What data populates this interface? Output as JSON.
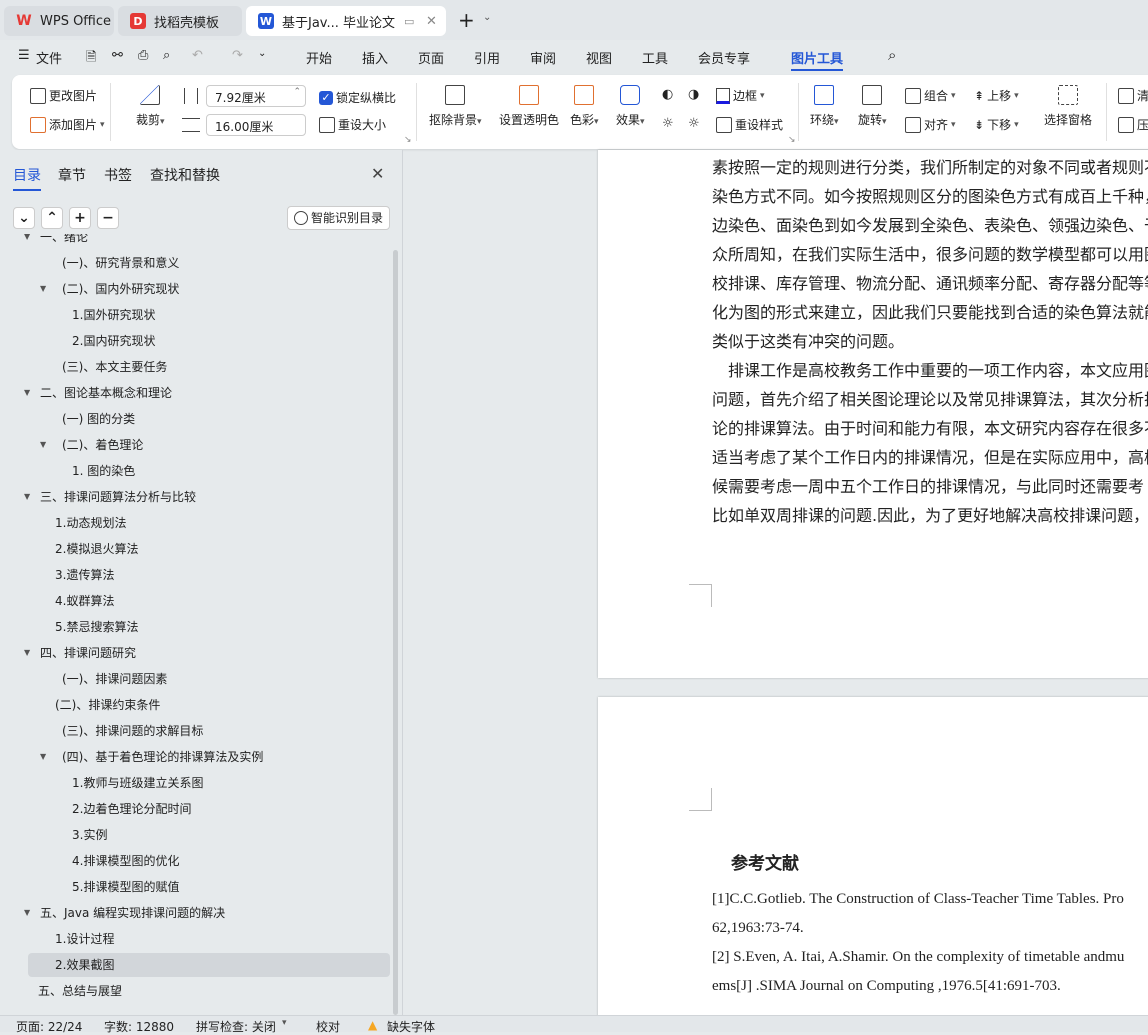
{
  "tabs": [
    {
      "label": "WPS Office",
      "logo": "W"
    },
    {
      "label": "找稻壳模板",
      "logo": "D"
    },
    {
      "label": "基于Jav... 毕业论文",
      "logo": "W"
    }
  ],
  "menu": {
    "file": "文件",
    "items": [
      "开始",
      "插入",
      "页面",
      "引用",
      "审阅",
      "视图",
      "工具",
      "会员专享",
      "图片工具"
    ],
    "active": "图片工具"
  },
  "ribbon": {
    "change_pic": "更改图片",
    "add_pic": "添加图片",
    "crop": "裁剪",
    "height": "7.92厘米",
    "width": "16.00厘米",
    "lock_ratio": "锁定纵横比",
    "lock_checked": true,
    "reset_size": "重设大小",
    "remove_bg": "抠除背景",
    "set_transparent": "设置透明色",
    "color": "色彩",
    "effect": "效果",
    "border": "边框",
    "reset_style": "重设样式",
    "wrap": "环绕",
    "rotate": "旋转",
    "group": "组合",
    "align": "对齐",
    "bring_forward": "上移",
    "send_backward": "下移",
    "selection_pane": "选择窗格",
    "clear": "清",
    "compress": "压"
  },
  "sidebar": {
    "tabs": [
      "目录",
      "章节",
      "书签",
      "查找和替换"
    ],
    "smart_toc": "智能识别目录",
    "toc": [
      {
        "label": "一、绪论",
        "level": 1,
        "expanded": true
      },
      {
        "label": "(一)、研究背景和意义",
        "level": 2
      },
      {
        "label": "(二)、国内外研究现状",
        "level": 2,
        "expanded": true
      },
      {
        "label": "1.国外研究现状",
        "level": 3
      },
      {
        "label": "2.国内研究现状",
        "level": 3
      },
      {
        "label": "(三)、本文主要任务",
        "level": 2
      },
      {
        "label": "二、图论基本概念和理论",
        "level": 1,
        "expanded": true
      },
      {
        "label": "(一) 图的分类",
        "level": 2
      },
      {
        "label": "(二)、着色理论",
        "level": 2,
        "expanded": true
      },
      {
        "label": "1. 图的染色",
        "level": 3
      },
      {
        "label": "三、排课问题算法分析与比较",
        "level": 1,
        "expanded": true
      },
      {
        "label": "1.动态规划法",
        "level": 4
      },
      {
        "label": "2.模拟退火算法",
        "level": 4
      },
      {
        "label": "3.遗传算法",
        "level": 4
      },
      {
        "label": "4.蚁群算法",
        "level": 4
      },
      {
        "label": "5.禁忌搜索算法",
        "level": 4
      },
      {
        "label": "四、排课问题研究",
        "level": 1,
        "expanded": true
      },
      {
        "label": "(一)、排课问题因素",
        "level": 2
      },
      {
        "label": "(二)、排课约束条件",
        "level": 4
      },
      {
        "label": "(三)、排课问题的求解目标",
        "level": 2
      },
      {
        "label": "(四)、基于着色理论的排课算法及实例",
        "level": 2,
        "expanded": true
      },
      {
        "label": "1.教师与班级建立关系图",
        "level": 3
      },
      {
        "label": "2.边着色理论分配时间",
        "level": 3
      },
      {
        "label": "3.实例",
        "level": 3
      },
      {
        "label": "4.排课模型图的优化",
        "level": 3
      },
      {
        "label": "5.排课模型图的赋值",
        "level": 3
      },
      {
        "label": "五、Java 编程实现排课问题的解决",
        "level": 1,
        "expanded": true
      },
      {
        "label": "1.设计过程",
        "level": 4
      },
      {
        "label": "2.效果截图",
        "level": 4,
        "selected": true
      },
      {
        "label": "五、总结与展望",
        "level": 5
      }
    ]
  },
  "document": {
    "body": [
      "素按照一定的规则进行分类，我们所制定的对象不同或者规则不",
      "染色方式不同。如今按照规则区分的图染色方式有成百上千种，",
      "边染色、面染色到如今发展到全染色、表染色、领强边染色、于",
      "众所周知，在我们实际生活中，很多问题的数学模型都可以用图",
      "校排课、库存管理、物流分配、通讯频率分配、寄存器分配等等",
      "化为图的形式来建立，因此我们只要能找到合适的染色算法就能",
      "类似于这类有冲突的问题。",
      "　排课工作是高校教务工作中重要的一项工作内容，本文应用图",
      "问题，首先介绍了相关图论理论以及常见排课算法，其次分析排",
      "论的排课算法。由于时间和能力有限，本文研究内容存在很多不",
      "适当考虑了某个工作日内的排课情况，但是在实际应用中，高校",
      "候需要考虑一周中五个工作日的排课情况，与此同时还需要考",
      "比如单双周排课的问题.因此，为了更好地解决高校排课问题，还"
    ],
    "ref_title": "参考文献",
    "refs": [
      "[1]C.C.Gotlieb. The Construction of Class-Teacher Time Tables. Pro",
      "62,1963:73-74.",
      "[2] S.Even, A. Itai, A.Shamir. On the complexity of timetable andmu",
      "ems[J] .SIMA Journal on Computing ,1976.5[41:691-703."
    ]
  },
  "status": {
    "page": "页面: 22/24",
    "words": "字数: 12880",
    "spell": "拼写检查: 关闭",
    "proof": "校对",
    "missing_font": "缺失字体"
  },
  "colors": {
    "accent": "#2457d6",
    "wps_red": "#e53935",
    "warning": "#f5a623"
  }
}
